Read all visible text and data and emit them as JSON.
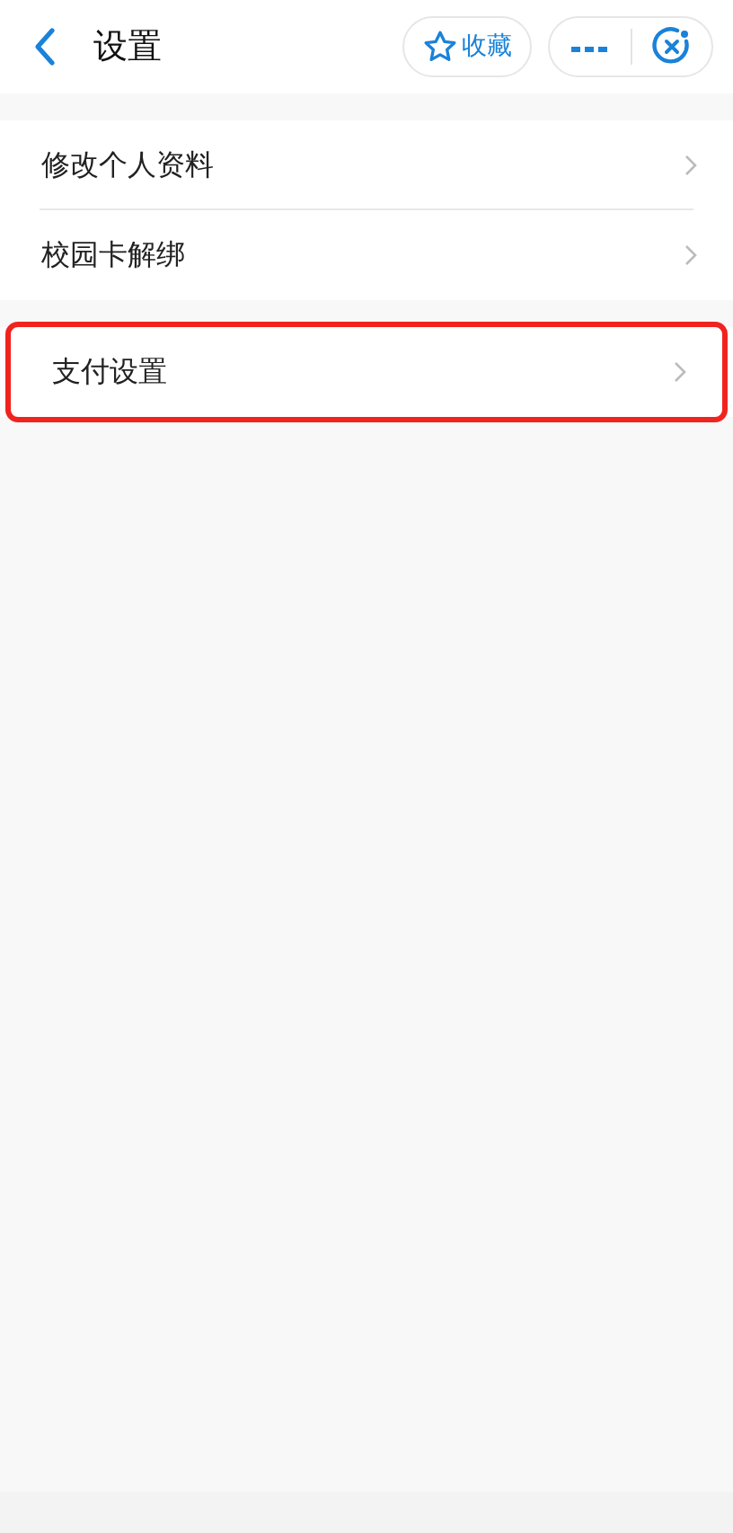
{
  "header": {
    "title": "设置",
    "favorite_label": "收藏"
  },
  "sections": [
    {
      "items": [
        {
          "label": "修改个人资料",
          "highlighted": false
        },
        {
          "label": "校园卡解绑",
          "highlighted": false
        }
      ]
    },
    {
      "items": [
        {
          "label": "支付设置",
          "highlighted": true
        }
      ]
    }
  ]
}
